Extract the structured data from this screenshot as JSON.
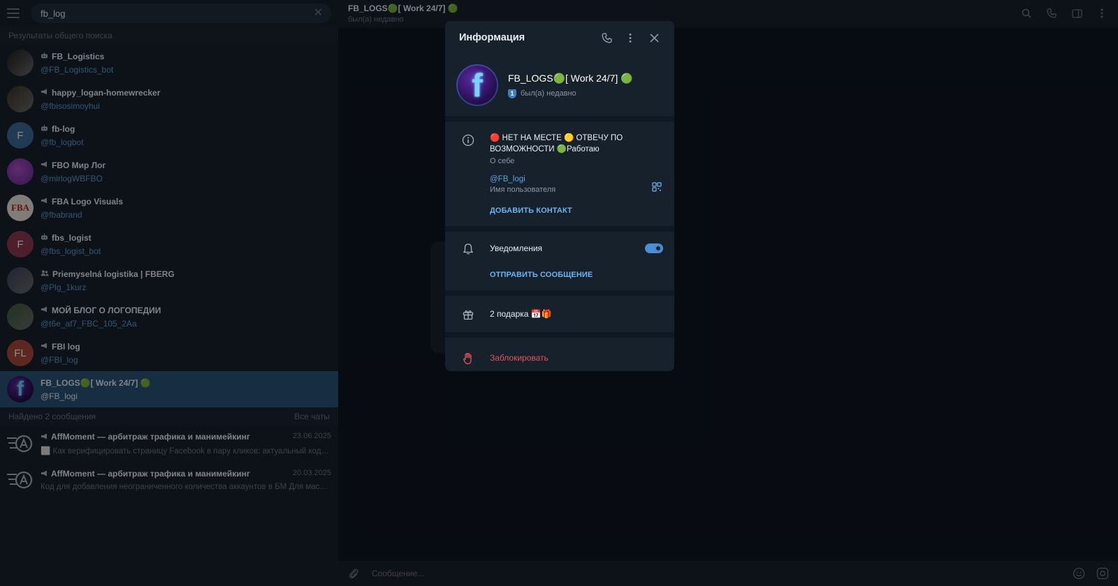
{
  "left": {
    "search_value": "fb_log",
    "global_header": "Результаты общего поиска",
    "results": [
      {
        "type_icon": "bot-icon",
        "title": "FB_Logistics",
        "sub": "@FB_Logistics_bot",
        "avatar": {
          "kind": "photo",
          "color": "#1d1d1d"
        }
      },
      {
        "type_icon": "channel-icon",
        "title": "happy_logan-homewrecker",
        "sub": "@fbisosimoyhui",
        "avatar": {
          "kind": "photo",
          "color": "#3a3226"
        }
      },
      {
        "type_icon": "bot-icon",
        "title": "fb-log",
        "sub": "@fb_logbot",
        "avatar": {
          "kind": "letter",
          "letter": "F",
          "color": "#3c6c99"
        }
      },
      {
        "type_icon": "channel-icon",
        "title": "FBO Мир Лог",
        "sub": "@mirlogWBFBO",
        "avatar": {
          "kind": "gradient",
          "color": "#7a3aa5"
        }
      },
      {
        "type_icon": "channel-icon",
        "title": "FBA Logo Visuals",
        "sub": "@fbabrand",
        "avatar": {
          "kind": "logo",
          "color": "#e9e4dc"
        }
      },
      {
        "type_icon": "bot-icon",
        "title": "fbs_logist",
        "sub": "@fbs_logist_bot",
        "avatar": {
          "kind": "letter",
          "letter": "F",
          "color": "#8d3a53"
        }
      },
      {
        "type_icon": "group-icon",
        "title": "Priemyselná logistika | FBERG",
        "sub": "@Plg_1kurz",
        "avatar": {
          "kind": "photo",
          "color": "#3b4460"
        }
      },
      {
        "type_icon": "channel-icon",
        "title": "МОЙ БЛОГ О ЛОГОПЕДИИ",
        "sub": "@t6e_af7_FBC_105_2Aa",
        "avatar": {
          "kind": "photo",
          "color": "#3d5b3a"
        }
      },
      {
        "type_icon": "channel-icon",
        "title": "FBI log",
        "sub": "@FBI_log",
        "avatar": {
          "kind": "letter",
          "letter": "FL",
          "color": "#a8493a"
        }
      },
      {
        "type_icon": "",
        "title": "FB_LOGS🟢[ Work 24/7] 🟢",
        "sub": "@FB_logi",
        "avatar": {
          "kind": "fb",
          "color": "#2a0f55"
        },
        "active": true
      }
    ],
    "messages_header": "Найдено 2 сообщения",
    "messages_filter": "Все чаты",
    "messages": [
      {
        "title": "AffMoment — арбитраж трафика и манимейкинг",
        "date": "23.06.2025",
        "text": "⬜ Как верифицировать страницу Facebook в пару кликов: актуальный код  П..."
      },
      {
        "title": "AffMoment — арбитраж трафика и манимейкинг",
        "date": "20.03.2025",
        "text": "Код для добавления неограниченного количества аккаунтов в БМ  Для масшт..."
      }
    ]
  },
  "chat": {
    "title": "FB_LOGS🟢[ Work 24/7] 🟢",
    "status": "был(а) недавно",
    "composer_placeholder": "Сообщение..."
  },
  "modal": {
    "title": "Информация",
    "name": "FB_LOGS🟢[ Work 24/7] 🟢",
    "status": "был(а) недавно",
    "badge": "1",
    "bio": "🔴 НЕТ НА МЕСТЕ 🟡 ОТВЕЧУ ПО ВОЗМОЖНОСТИ 🟢Работаю",
    "bio_caption": "О себе",
    "username": "@FB_logi",
    "username_caption": "Имя пользователя",
    "add_contact": "ДОБАВИТЬ КОНТАКТ",
    "notifications_label": "Уведомления",
    "notifications_on": true,
    "send_message": "ОТПРАВИТЬ СООБЩЕНИЕ",
    "gifts": "2 подарка 📅🎁",
    "block": "Заблокировать"
  },
  "colors": {
    "accent": "#6ab3f3",
    "danger": "#e5535b",
    "active_row": "#2b5278",
    "panel": "#17212b",
    "background": "#0e1621"
  }
}
